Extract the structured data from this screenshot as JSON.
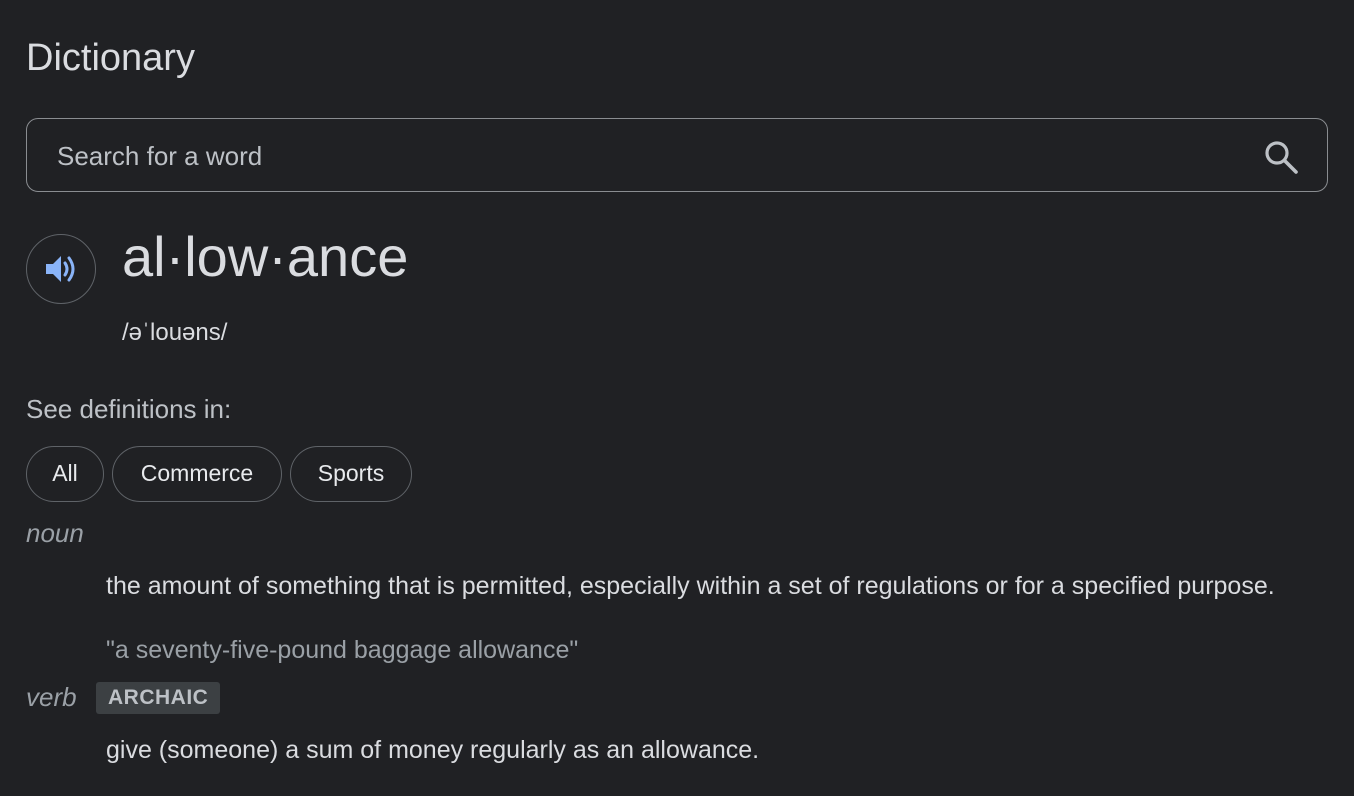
{
  "header": {
    "title": "Dictionary"
  },
  "search": {
    "placeholder": "Search for a word",
    "value": ""
  },
  "entry": {
    "headword": "al·low·ance",
    "phonetic": "/əˈlouəns/",
    "see_definitions_label": "See definitions in:",
    "chips": [
      {
        "label": "All"
      },
      {
        "label": "Commerce"
      },
      {
        "label": "Sports"
      }
    ],
    "senses": [
      {
        "pos": "noun",
        "definition": "the amount of something that is permitted, especially within a set of regulations or for a specified purpose.",
        "example": "\"a seventy-five-pound baggage allowance\""
      },
      {
        "pos": "verb",
        "label": "ARCHAIC",
        "definition": "give (someone) a sum of money regularly as an allowance."
      }
    ]
  },
  "icons": {
    "search": "search-icon",
    "audio": "speaker-icon"
  },
  "colors": {
    "background": "#202124",
    "accent": "#8ab4f8",
    "text": "#e8eaed"
  }
}
